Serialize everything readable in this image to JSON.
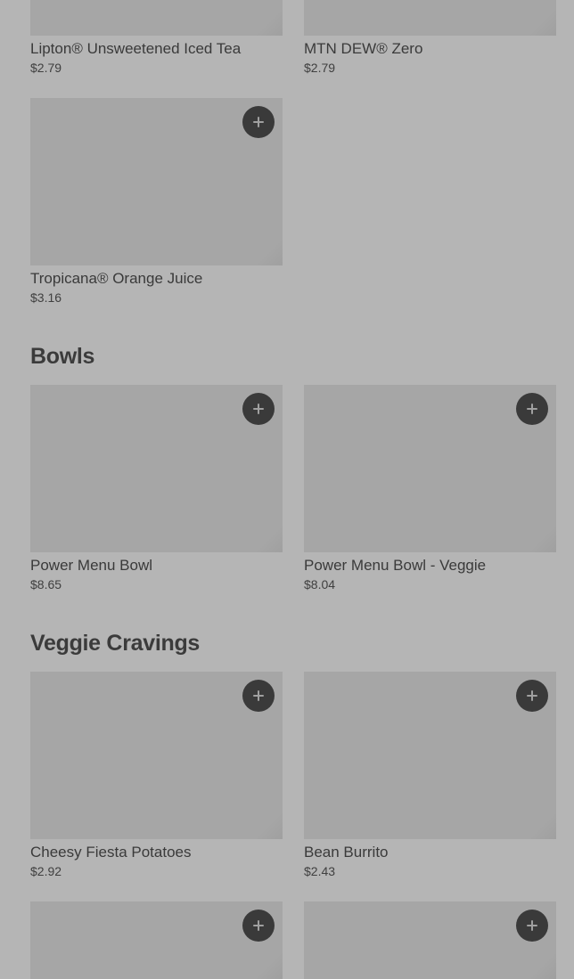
{
  "sections": {
    "drinks": {
      "items": [
        {
          "name": "Lipton® Unsweetened Iced Tea",
          "price": "$2.79"
        },
        {
          "name": "MTN DEW® Zero",
          "price": "$2.79"
        },
        {
          "name": "Tropicana® Orange Juice",
          "price": "$3.16"
        }
      ]
    },
    "bowls": {
      "title": "Bowls",
      "items": [
        {
          "name": "Power Menu Bowl",
          "price": "$8.65"
        },
        {
          "name": "Power Menu Bowl - Veggie",
          "price": "$8.04"
        }
      ]
    },
    "veggie": {
      "title": "Veggie Cravings",
      "items": [
        {
          "name": "Cheesy Fiesta Potatoes",
          "price": "$2.92"
        },
        {
          "name": "Bean Burrito",
          "price": "$2.43"
        }
      ]
    }
  },
  "icons": {
    "add": "plus-icon"
  },
  "colors": {
    "background": "#b5b5b5",
    "image_placeholder": "#a6a6a6",
    "add_button": "#3a3a3a",
    "text": "#3a3a3a"
  }
}
